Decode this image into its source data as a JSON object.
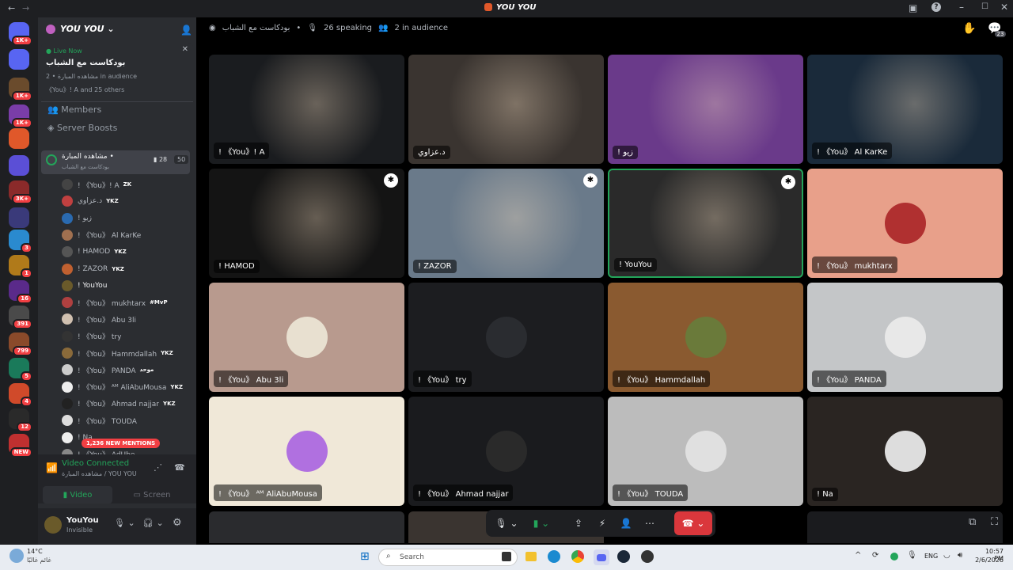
{
  "titlebar": {
    "title": "YOU YOU",
    "badge_count": "23"
  },
  "servers": [
    {
      "badge": "1K+",
      "color": "#5865f2"
    },
    {
      "badge": "",
      "color": "#5865f2"
    },
    {
      "badge": "1K+",
      "color": "#6a4b2c"
    },
    {
      "badge": "1K+",
      "color": "#7a3da8"
    },
    {
      "badge": "",
      "color": "#e0582a"
    },
    {
      "badge": "",
      "color": "#5b4fd6"
    },
    {
      "badge": "3K+",
      "color": "#8a2a2a"
    },
    {
      "badge": "",
      "color": "#3a3a7a"
    },
    {
      "badge": "3",
      "color": "#2a8acf"
    },
    {
      "badge": "1",
      "color": "#b07a1a"
    },
    {
      "badge": "16",
      "color": "#5a2a8a"
    },
    {
      "badge": "391",
      "color": "#4a4a4a"
    },
    {
      "badge": "799",
      "color": "#8a4a2a"
    },
    {
      "badge": "5",
      "color": "#1a7a5a"
    },
    {
      "badge": "4",
      "color": "#d04a2a"
    },
    {
      "badge": "12",
      "color": "#2a2a2a"
    },
    {
      "badge": "NEW",
      "color": "#c03030"
    }
  ],
  "server_header": {
    "name": "YOU YOU"
  },
  "live_card": {
    "status": "Live Now",
    "title": "بودكاست مع الشباب",
    "meta": "مشاهده المبارة • 2 in audience",
    "meta2": "《You》! A and 25 others"
  },
  "nav": {
    "members": "Members",
    "boosts": "Server Boosts"
  },
  "channel": {
    "name": "مشاهده المبارة •",
    "subtitle": "بودكاست مع الشباب",
    "cams": "28",
    "count": "50"
  },
  "members": [
    {
      "name": "! 《You》! A",
      "tag": "ZK",
      "color": "#444"
    },
    {
      "name": "د.عزاوي",
      "tag": "YKZ",
      "color": "#c04040"
    },
    {
      "name": "! زيو",
      "tag": "",
      "color": "#2a6ab0"
    },
    {
      "name": "! 《You》 Al KarKe",
      "tag": "",
      "color": "#a07050"
    },
    {
      "name": "! HAMOD",
      "tag": "YKZ",
      "color": "#555"
    },
    {
      "name": "! ZAZOR",
      "tag": "YKZ",
      "color": "#c06030"
    },
    {
      "name": "! YouYou",
      "tag": "",
      "color": "#6a5a2a"
    },
    {
      "name": "! 《You》 mukhtarx",
      "tag": "#MvP",
      "color": "#b04040"
    },
    {
      "name": "! 《You》 Abu 3li",
      "tag": "",
      "color": "#d0c0b0"
    },
    {
      "name": "! 《You》 try",
      "tag": "",
      "color": "#333"
    },
    {
      "name": "! 《You》 Hammdallah",
      "tag": "YKZ",
      "color": "#8a6a3a"
    },
    {
      "name": "! 《You》 PANDA",
      "tag": "موحد",
      "color": "#ccc"
    },
    {
      "name": "! 《You》 ᴬᴹ AliAbuMousa",
      "tag": "YKZ",
      "color": "#eee"
    },
    {
      "name": "! 《You》 Ahmad najjar",
      "tag": "YKZ",
      "color": "#222"
    },
    {
      "name": "! 《You》 TOUDA",
      "tag": "",
      "color": "#ddd"
    },
    {
      "name": "! Na",
      "tag": "",
      "color": "#eee"
    },
    {
      "name": "! 《You》 AdUbe",
      "tag": "",
      "color": "#888"
    }
  ],
  "mentions": "1,236 NEW MENTIONS",
  "voice": {
    "status": "Video Connected",
    "channel": "مشاهده المبارة / YOU YOU",
    "video": "Video",
    "screen": "Screen"
  },
  "user": {
    "name": "YouYou",
    "status": "Invisible"
  },
  "stage": {
    "title": "بودكاست مع الشباب",
    "speaking": "26 speaking",
    "audience": "2 in audience"
  },
  "tiles": [
    {
      "name": "! 《You》! A",
      "bg": "#1a1c1f",
      "avatar": "",
      "video": true
    },
    {
      "name": "د.عزاوي",
      "bg": "#3a3430",
      "avatar": "",
      "video": true
    },
    {
      "name": "! زيو",
      "bg": "#6a3a8a",
      "avatar": "",
      "video": true
    },
    {
      "name": "! 《You》 Al KarKe",
      "bg": "#1a2a3a",
      "avatar": "",
      "video": true
    },
    {
      "name": "! HAMOD",
      "bg": "#141414",
      "avatar": "",
      "video": true
    },
    {
      "name": "! ZAZOR",
      "bg": "#6a7a8a",
      "avatar": "",
      "video": true
    },
    {
      "name": "! YouYou",
      "bg": "#2a2a2a",
      "avatar": "",
      "video": true
    },
    {
      "name": "! 《You》 mukhtarx",
      "bg": "#e8a08a",
      "avatar": "#b03030",
      "video": false
    },
    {
      "name": "! 《You》 Abu 3li",
      "bg": "#b89a8e",
      "avatar": "#e8e0d0",
      "video": false
    },
    {
      "name": "! 《You》 try",
      "bg": "#1c1d20",
      "avatar": "#2a2c30",
      "video": false
    },
    {
      "name": "! 《You》 Hammdallah",
      "bg": "#8a5a30",
      "avatar": "#6a7a3a",
      "video": false
    },
    {
      "name": "! 《You》 PANDA",
      "bg": "#c4c6c8",
      "avatar": "#e8e8e8",
      "video": false
    },
    {
      "name": "! 《You》 ᴬᴹ AliAbuMousa",
      "bg": "#f0e8d8",
      "avatar": "#b070e0",
      "video": false
    },
    {
      "name": "! 《You》 Ahmad najjar",
      "bg": "#1a1b1e",
      "avatar": "#2a2a2a",
      "video": false
    },
    {
      "name": "! 《You》 TOUDA",
      "bg": "#bcbcbc",
      "avatar": "#e0e0e0",
      "video": false
    },
    {
      "name": "! Na",
      "bg": "#2a2522",
      "avatar": "#ddd",
      "video": false
    }
  ],
  "taskbar": {
    "temp": "14°C",
    "weather": "غائم غالبًا",
    "search": "Search",
    "lang": "ENG",
    "time": "10:57 PM",
    "date": "2/6/2026"
  }
}
